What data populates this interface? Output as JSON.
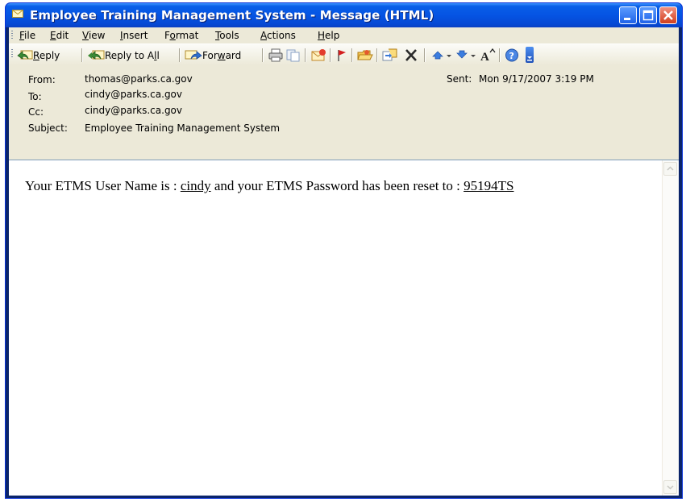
{
  "window": {
    "title": "Employee Training Management System - Message (HTML)"
  },
  "menu": {
    "items": [
      {
        "label": "File",
        "accel": "F",
        "rest": "ile"
      },
      {
        "label": "Edit",
        "accel": "E",
        "rest": "dit"
      },
      {
        "label": "View",
        "accel": "V",
        "rest": "iew"
      },
      {
        "label": "Insert",
        "accel": "I",
        "rest": "nsert"
      },
      {
        "label": "Format",
        "pre": "F",
        "accel": "o",
        "rest": "rmat"
      },
      {
        "label": "Tools",
        "accel": "T",
        "rest": "ools"
      },
      {
        "label": "Actions",
        "accel": "A",
        "rest": "ctions"
      },
      {
        "label": "Help",
        "accel": "H",
        "rest": "elp"
      }
    ]
  },
  "toolbar": {
    "reply_accel": "R",
    "reply_rest": "eply",
    "reply_all_pre": "Reply to A",
    "reply_all_accel": "l",
    "reply_all_rest": "l",
    "forward_pre": "For",
    "forward_accel": "w",
    "forward_rest": "ard",
    "icons": [
      "reply-icon",
      "reply-all-icon",
      "forward-icon",
      "print-icon",
      "copy-icon",
      "send-receive-icon",
      "flag-icon",
      "open-folder-icon",
      "move-to-folder-icon",
      "delete-icon",
      "previous-item-icon",
      "next-item-icon",
      "font-size-icon",
      "help-icon",
      "toolbar-options-icon"
    ]
  },
  "header": {
    "from_label": "From:",
    "from_value": "thomas@parks.ca.gov",
    "sent_label": "Sent:",
    "sent_value": "Mon 9/17/2007 3:19 PM",
    "to_label": "To:",
    "to_value": "cindy@parks.ca.gov",
    "cc_label": "Cc:",
    "cc_value": "cindy@parks.ca.gov",
    "subject_label": "Subject:",
    "subject_value": "Employee Training Management System"
  },
  "message": {
    "part1": "Your ETMS User Name is : ",
    "username": "cindy",
    "part2": " and your ETMS Password has been reset to : ",
    "password": "95194TS"
  },
  "colors": {
    "titlebar": "#0554e3",
    "header_bg": "#ece9d8",
    "close_button": "#d1401e"
  }
}
